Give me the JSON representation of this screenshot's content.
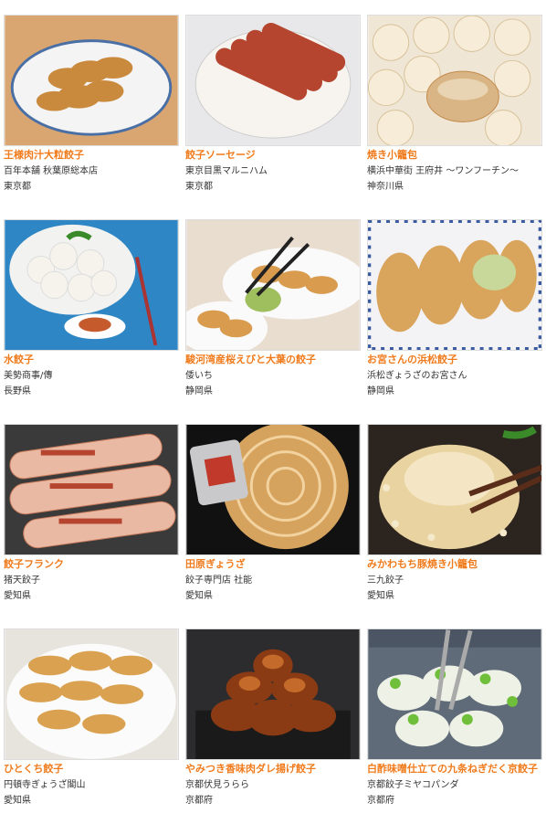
{
  "accent_color": "#f07b1d",
  "items": [
    {
      "name": "王様肉汁大粒餃子",
      "shop": "百年本舗 秋葉原総本店",
      "prefecture": "東京都",
      "icon": "gyoza-plate-image"
    },
    {
      "name": "餃子ソーセージ",
      "shop": "東京目黒マルニハム",
      "prefecture": "東京都",
      "icon": "sausage-image"
    },
    {
      "name": "焼き小籠包",
      "shop": "横浜中華街 王府井 ～ワンフーチン～",
      "prefecture": "神奈川県",
      "icon": "xiaolongbao-image"
    },
    {
      "name": "水餃子",
      "shop": "美勢商事/傳",
      "prefecture": "長野県",
      "icon": "boiled-dumpling-image"
    },
    {
      "name": "駿河湾産桜えびと大葉の餃子",
      "shop": "倭いち",
      "prefecture": "静岡県",
      "icon": "shrimp-gyoza-image"
    },
    {
      "name": "お宮さんの浜松餃子",
      "shop": "浜松ぎょうざのお宮さん",
      "prefecture": "静岡県",
      "icon": "hamamatsu-gyoza-image"
    },
    {
      "name": "餃子フランク",
      "shop": "猪天餃子",
      "prefecture": "愛知県",
      "icon": "frank-sausage-image"
    },
    {
      "name": "田原ぎょうざ",
      "shop": "餃子専門店 社能",
      "prefecture": "愛知県",
      "icon": "tahara-gyoza-image"
    },
    {
      "name": "みかわもち豚焼き小籠包",
      "shop": "三九餃子",
      "prefecture": "愛知県",
      "icon": "mikawa-xiaolongbao-image"
    },
    {
      "name": "ひとくち餃子",
      "shop": "円頓寺ぎょうざ閣山",
      "prefecture": "愛知県",
      "icon": "bite-gyoza-image"
    },
    {
      "name": "やみつき香味肉ダレ揚げ餃子",
      "shop": "京都伏見うらら",
      "prefecture": "京都府",
      "icon": "fried-gyoza-image"
    },
    {
      "name": "白酢味噌仕立ての九条ねぎだく京餃子",
      "shop": "京都餃子ミヤコパンダ",
      "prefecture": "京都府",
      "icon": "kujo-negi-gyoza-image"
    }
  ]
}
